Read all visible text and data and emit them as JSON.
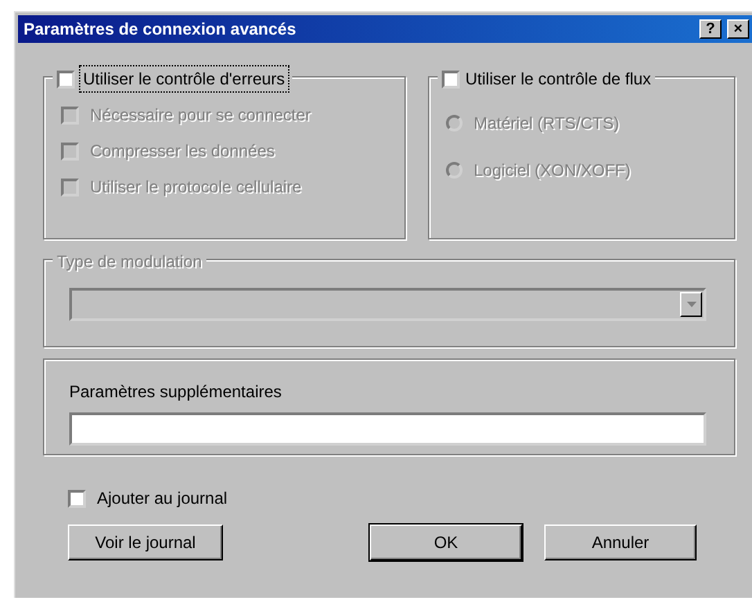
{
  "window": {
    "title": "Paramètres de connexion avancés",
    "buttons": [
      {
        "kind": "help",
        "label": "?"
      },
      {
        "kind": "close",
        "label": "×"
      }
    ]
  },
  "error_control": {
    "label": "Utiliser le contrôle d'erreurs",
    "checked": false,
    "focused": true,
    "options": [
      {
        "label": "Nécessaire pour se connecter",
        "checked": false,
        "disabled": true
      },
      {
        "label": "Compresser les données",
        "checked": false,
        "disabled": true
      },
      {
        "label": "Utiliser le protocole cellulaire",
        "checked": false,
        "disabled": true
      }
    ]
  },
  "flow_control": {
    "label": "Utiliser le contrôle de flux",
    "checked": false,
    "options": [
      {
        "label": "Matériel (RTS/CTS)",
        "selected": false,
        "disabled": true
      },
      {
        "label": "Logiciel (XON/XOFF)",
        "selected": false,
        "disabled": true
      }
    ]
  },
  "modulation": {
    "label": "Type de modulation",
    "disabled": true
  },
  "extra_settings": {
    "label": "Paramètres supplémentaires"
  },
  "log": {
    "label": "Ajouter au journal",
    "checked": false
  },
  "buttons": [
    {
      "label": "Voir le journal",
      "default": false
    },
    {
      "label": "OK",
      "default": true
    },
    {
      "label": "Annuler",
      "default": false
    }
  ]
}
